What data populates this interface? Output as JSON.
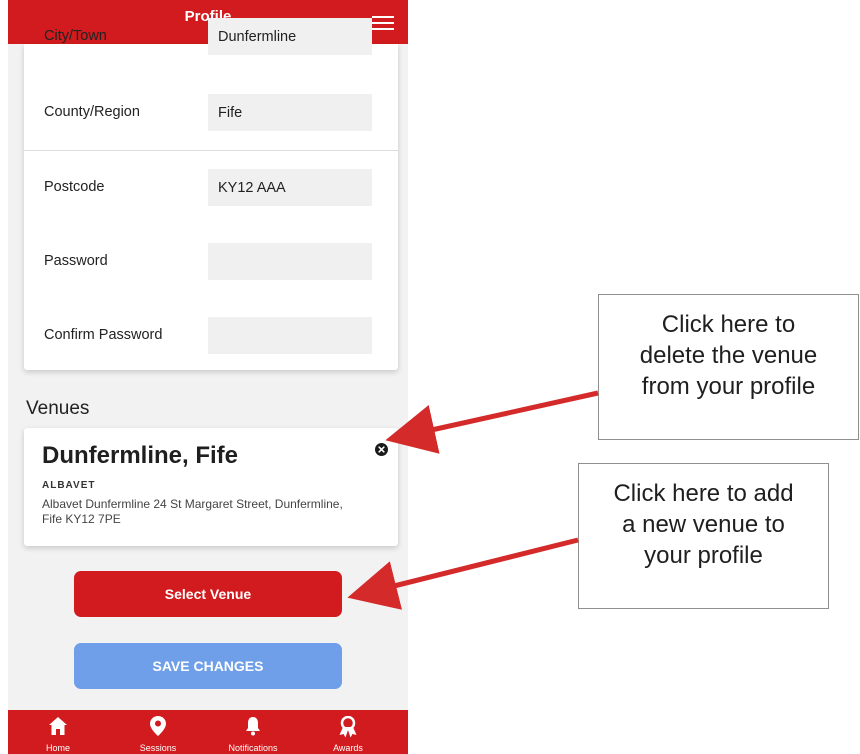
{
  "header": {
    "title": "Profile",
    "menu_icon": "hamburger-menu-icon"
  },
  "form": {
    "city_town": {
      "label": "City/Town",
      "value": "Dunfermline"
    },
    "county": {
      "label": "County/Region",
      "value": "Fife"
    },
    "postcode": {
      "label": "Postcode",
      "value": "KY12 AAA"
    },
    "password": {
      "label": "Password",
      "value": ""
    },
    "confirm_password": {
      "label": "Confirm Password",
      "value": ""
    }
  },
  "venues": {
    "heading": "Venues",
    "items": [
      {
        "name": "Dunfermline, Fife",
        "tag": "ALBAVET",
        "address": "Albavet Dunfermline 24 St Margaret Street, Dunfermline,  Fife KY12 7PE"
      }
    ]
  },
  "buttons": {
    "select_venue": "Select Venue",
    "save_changes": "SAVE CHANGES"
  },
  "nav": [
    {
      "label": "Home",
      "icon": "home-icon"
    },
    {
      "label": "Sessions",
      "icon": "map-pin-icon"
    },
    {
      "label": "Notifications",
      "icon": "bell-icon"
    },
    {
      "label": "Awards",
      "icon": "award-icon"
    }
  ],
  "callouts": {
    "delete": {
      "lines": [
        "Click here to",
        "delete the venue",
        "from your profile"
      ]
    },
    "add": {
      "lines": [
        "Click here to add",
        "a new venue to",
        "your profile"
      ]
    }
  },
  "colors": {
    "brand_red": "#d11b1e",
    "save_blue": "#6f9fe8",
    "arrow_red": "#d42a2a"
  }
}
